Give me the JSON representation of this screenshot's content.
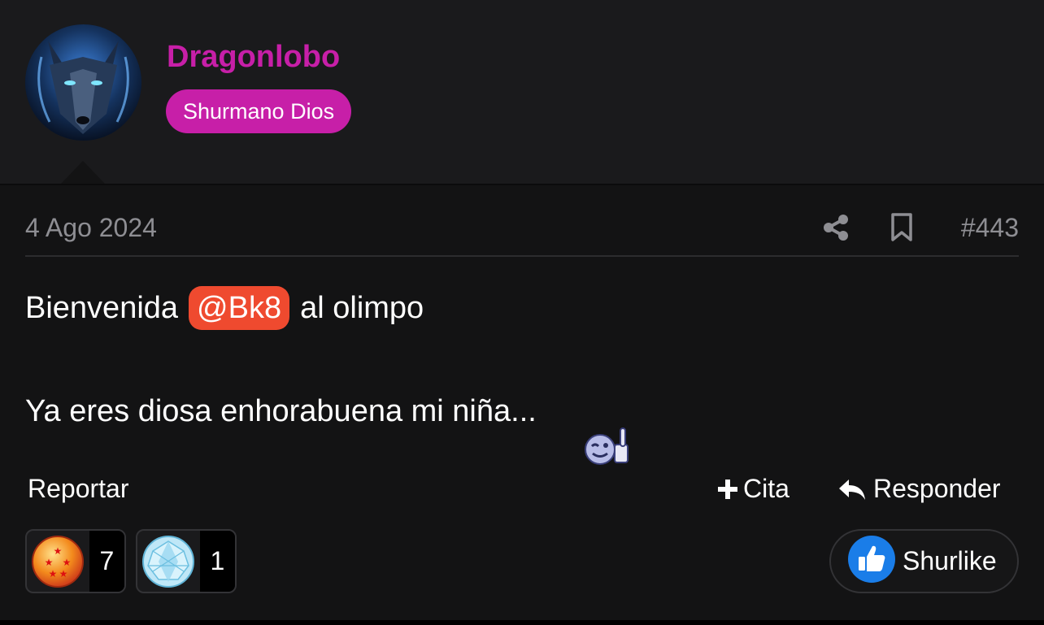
{
  "author": {
    "name": "Dragonlobo",
    "rank": "Shurmano Dios",
    "avatar_icon": "wolf-avatar"
  },
  "post": {
    "date": "4 Ago 2024",
    "number": "#443",
    "line1_before": "Bienvenida",
    "mention": "@Bk8",
    "line1_after": "al olimpo",
    "line2": "Ya eres diosa enhorabuena mi niña...",
    "smiley_icon": "thumbs-up-smiley"
  },
  "actions": {
    "report": "Reportar",
    "quote": "Cita",
    "reply": "Responder",
    "like": "Shurlike"
  },
  "reactions": [
    {
      "icon": "dragon-ball-icon",
      "count": "7"
    },
    {
      "icon": "diamond-icon",
      "count": "1"
    }
  ],
  "colors": {
    "brand": "#c71fa8",
    "mention": "#ef4a2f",
    "background": "#131314",
    "header": "#1a1a1c",
    "like_blue": "#1a7de8"
  }
}
